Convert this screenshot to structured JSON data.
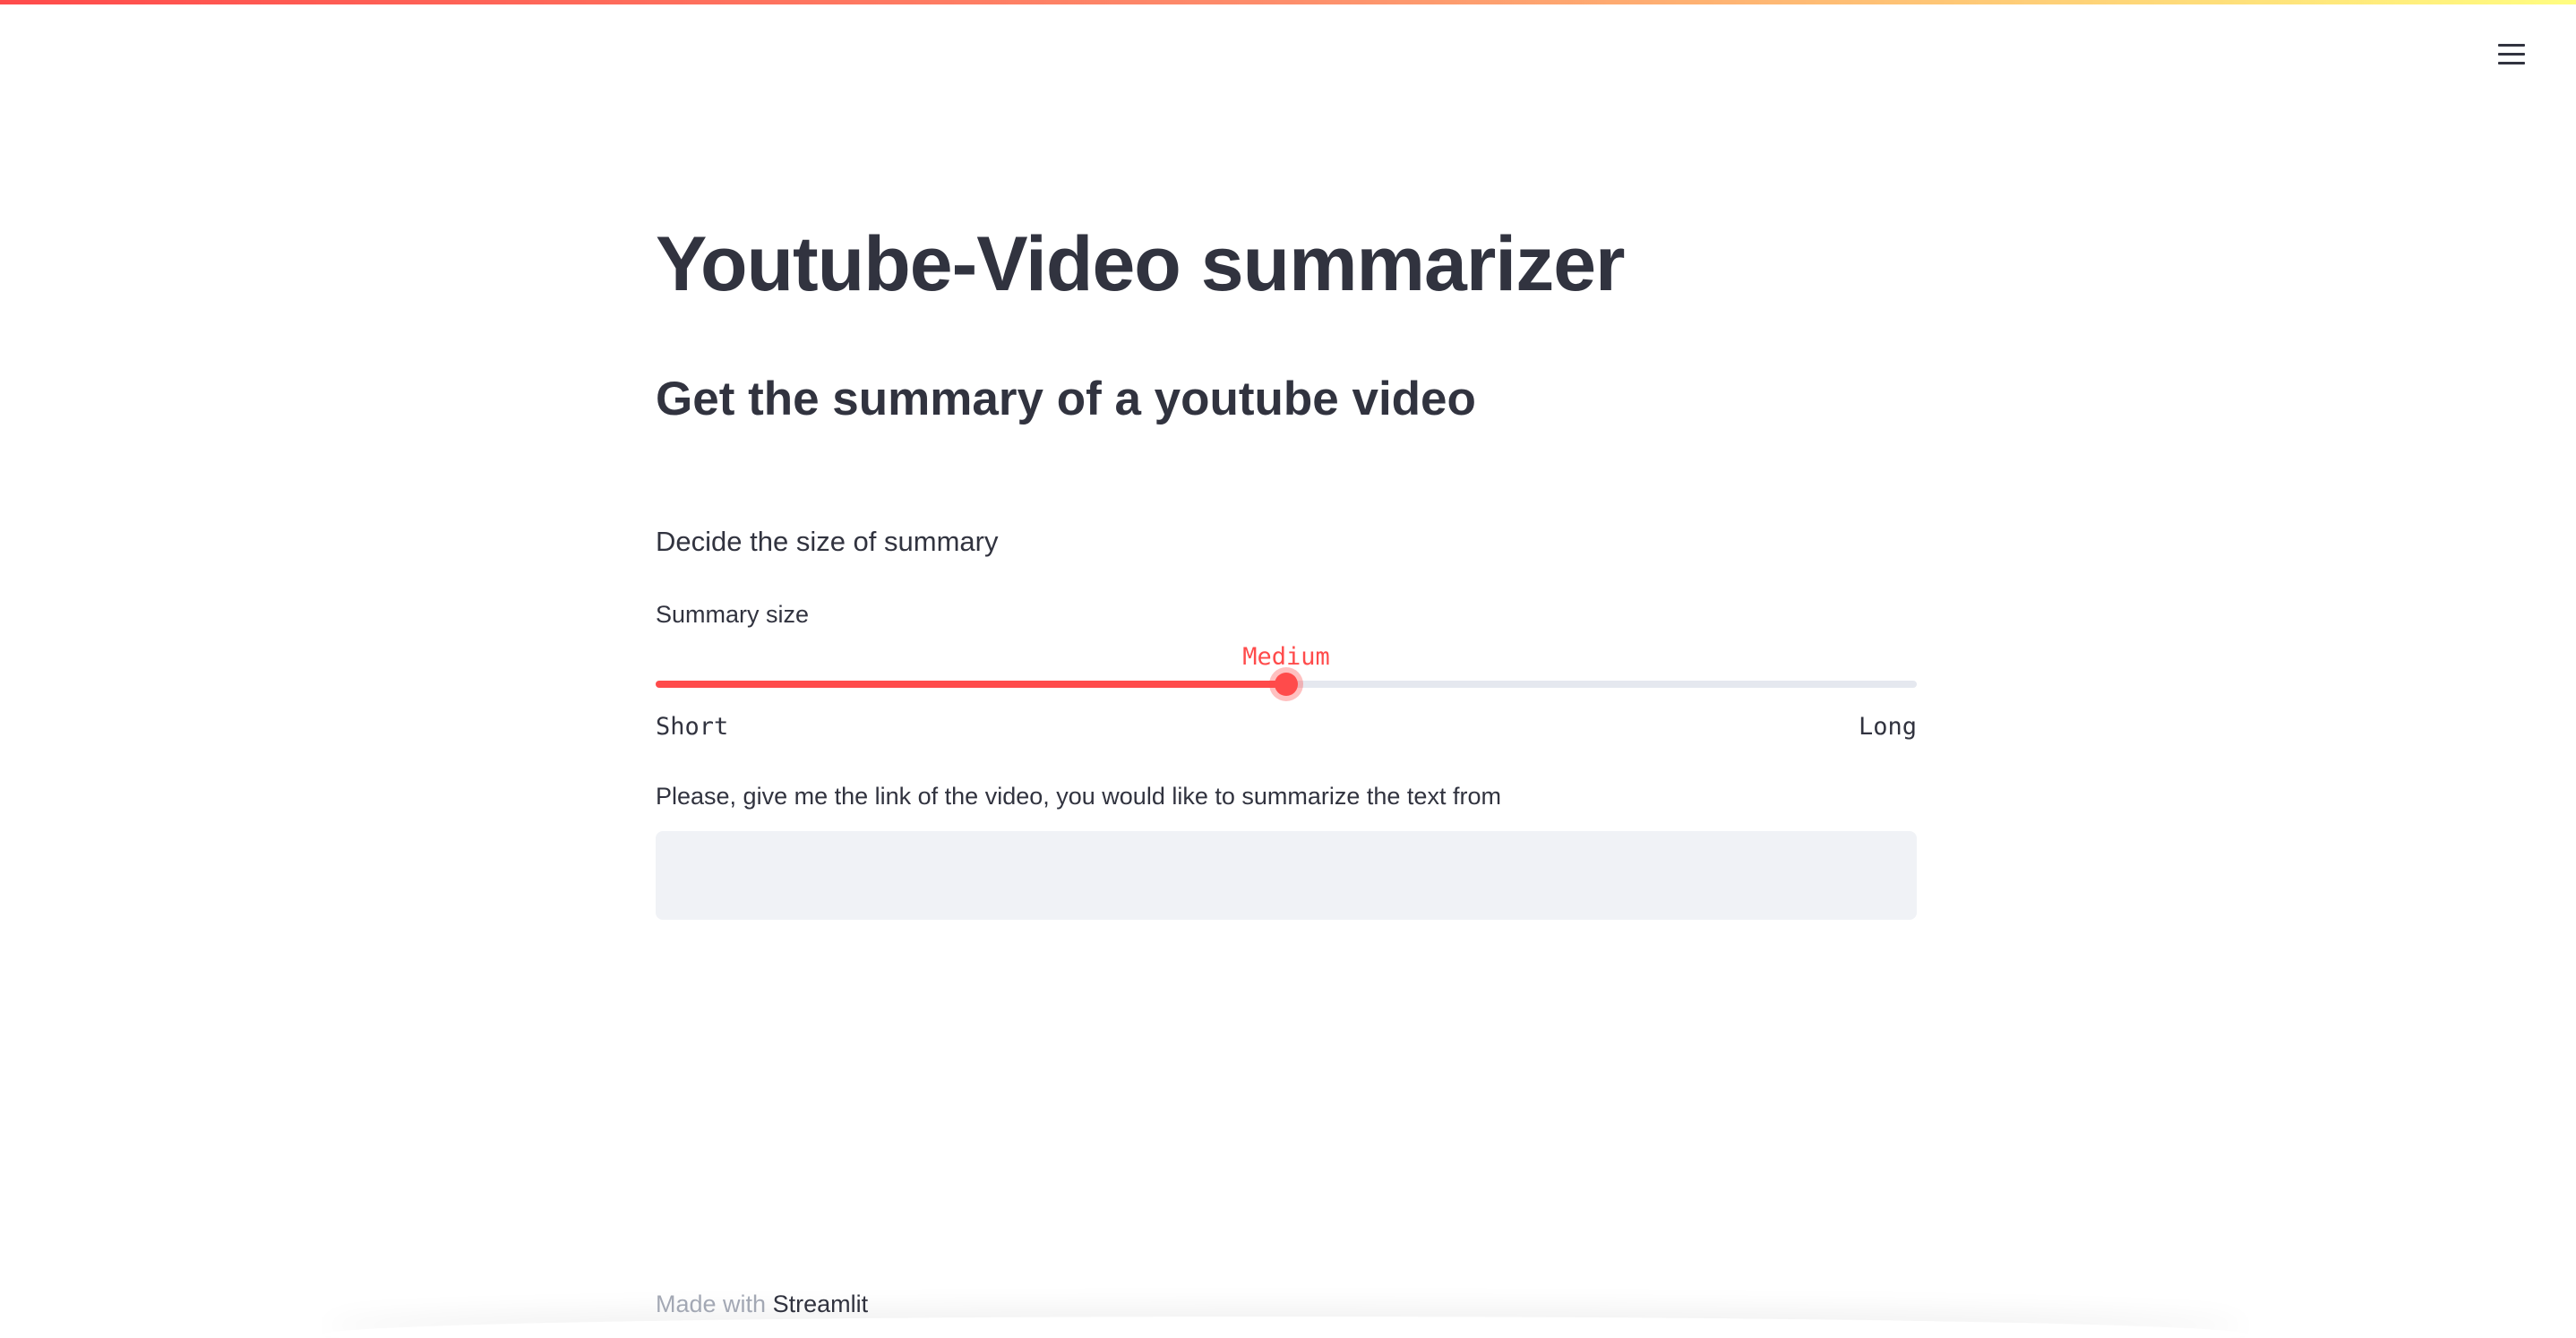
{
  "header": {
    "menu_icon": "hamburger-menu-icon",
    "accent_colors": [
      "#ff4b4b",
      "#fd8e6c",
      "#fffd80"
    ]
  },
  "main": {
    "title": "Youtube-Video summarizer",
    "subtitle": "Get the summary of a youtube video",
    "instruction": "Decide the size of summary",
    "slider": {
      "label": "Summary size",
      "options": [
        "Short",
        "Medium",
        "Long"
      ],
      "current_value": "Medium",
      "min_label": "Short",
      "max_label": "Long",
      "position_fraction": 0.5,
      "accent_color": "#ff4b4b"
    },
    "link_input": {
      "label": "Please, give me the link of the video, you would like to summarize the text from",
      "value": "",
      "placeholder": ""
    }
  },
  "footer": {
    "prefix": "Made with",
    "link": "Streamlit"
  }
}
